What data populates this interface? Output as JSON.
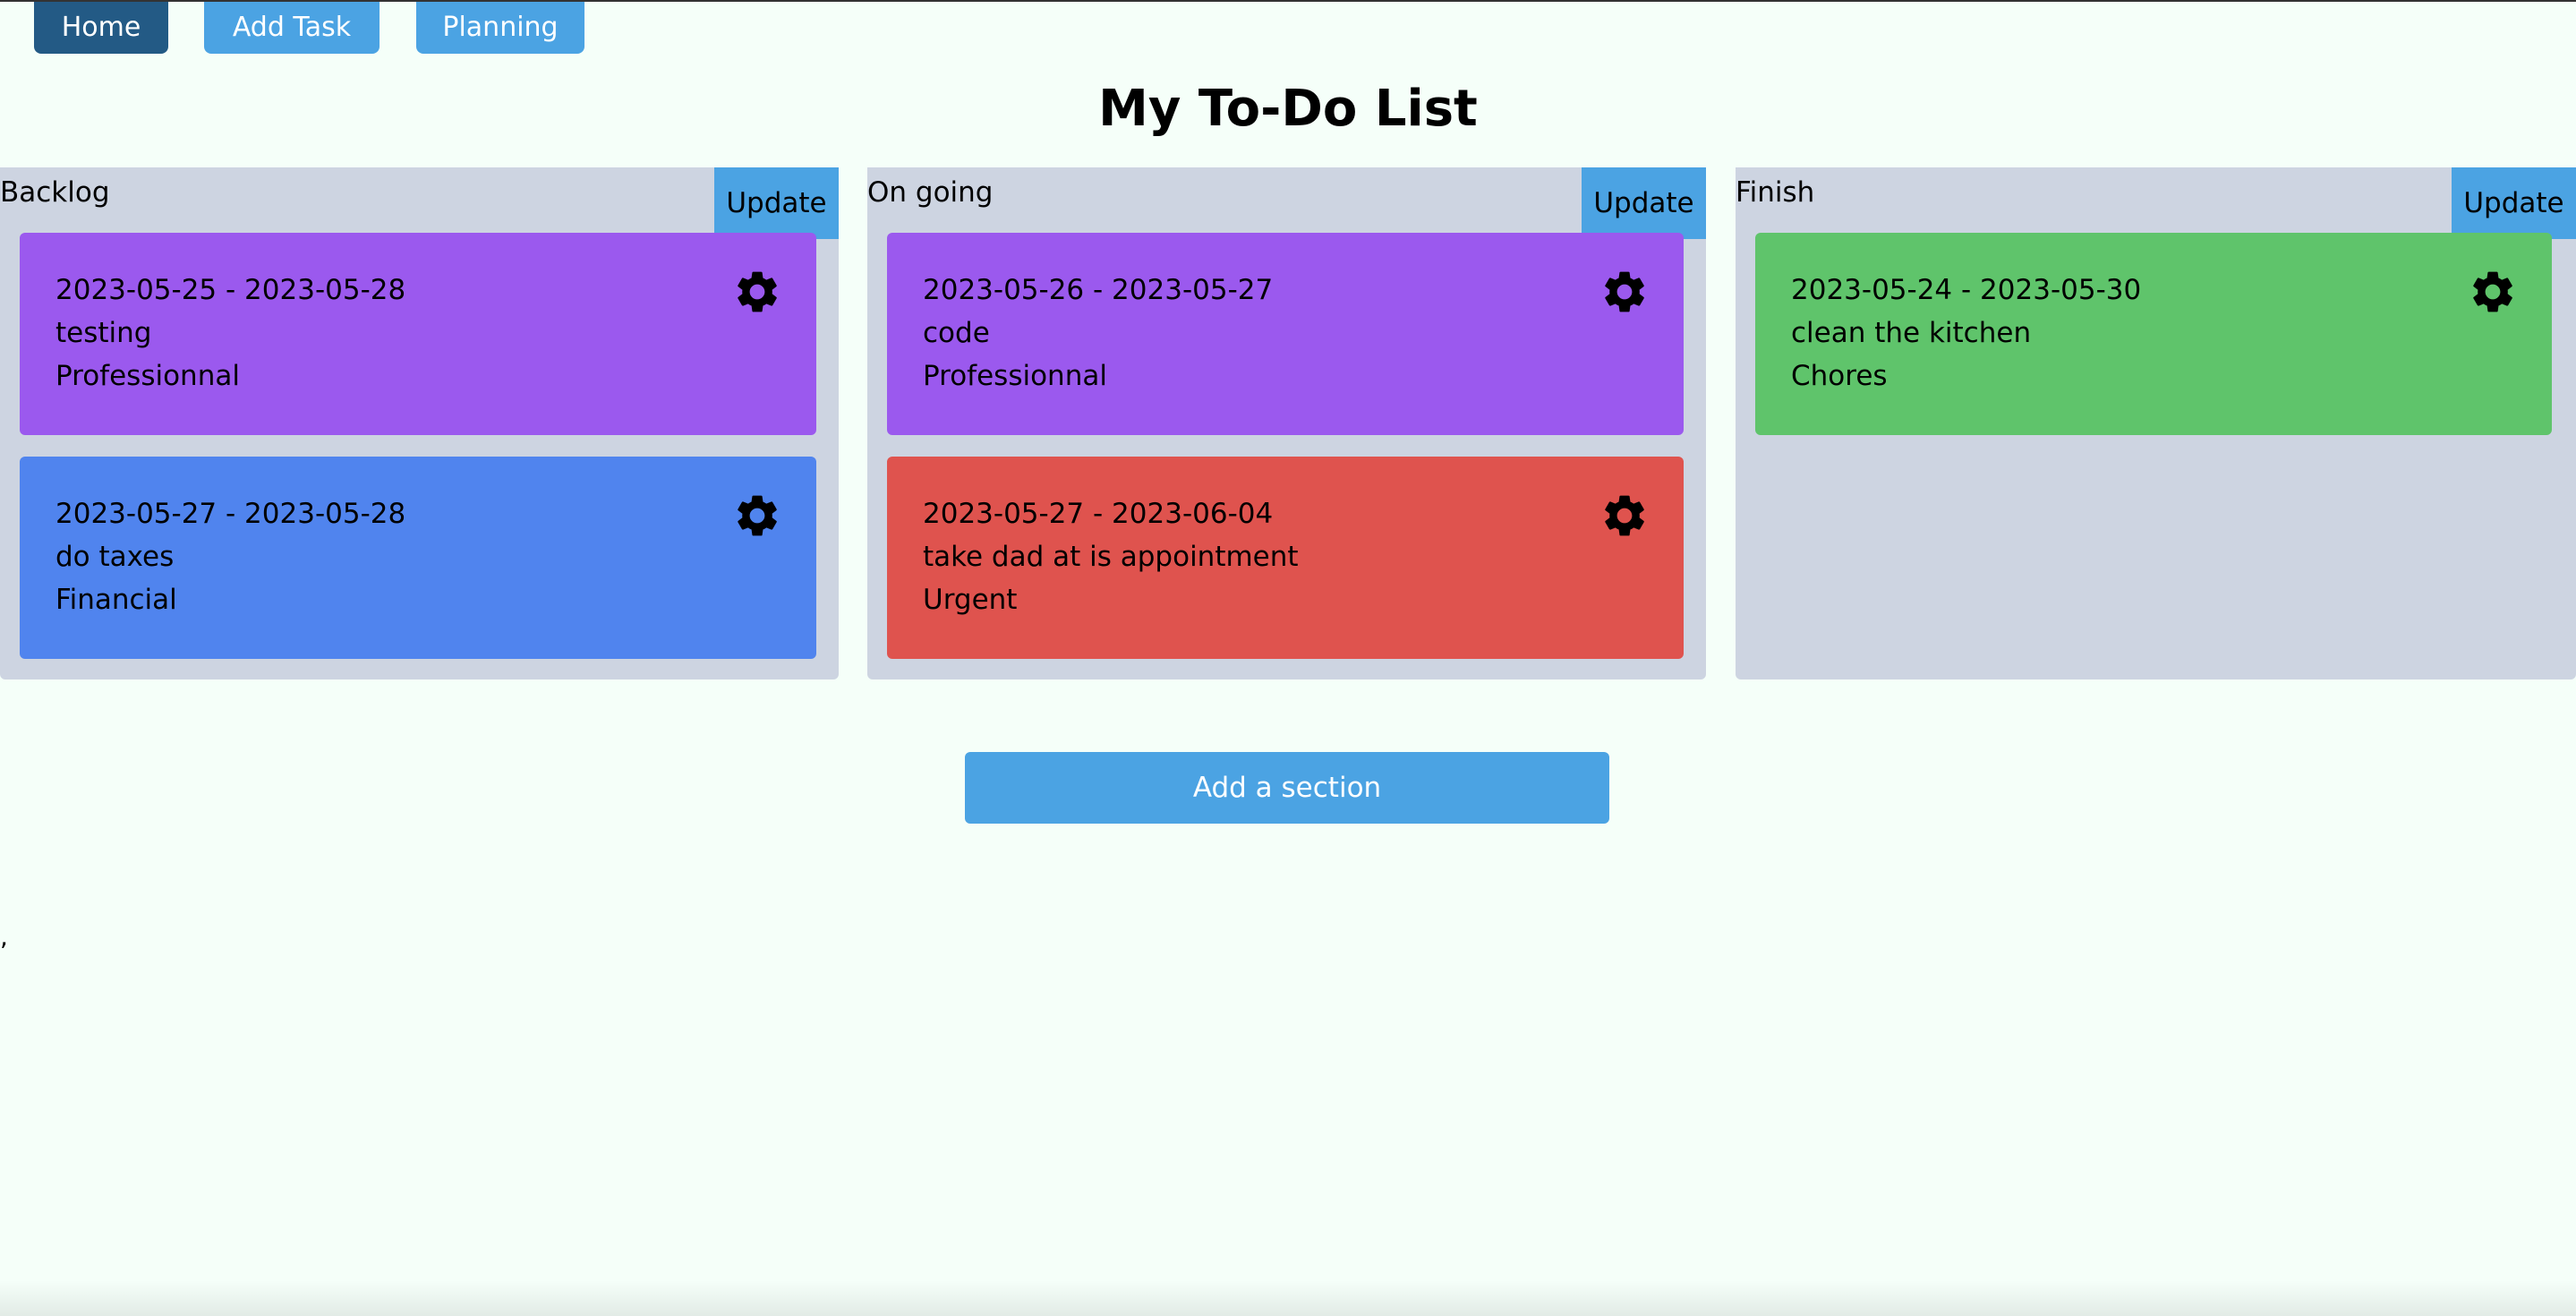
{
  "nav": {
    "home_label": "Home",
    "add_task_label": "Add Task",
    "planning_label": "Planning"
  },
  "page": {
    "title": "My To-Do List",
    "add_section_label": "Add a section",
    "stray_mark": ","
  },
  "sections": [
    {
      "title": "Backlog",
      "update_label": "Update",
      "tasks": [
        {
          "dates": "2023-05-25 - 2023-05-28",
          "name": "testing",
          "category": "Professionnal",
          "color": "#9b59ee",
          "icon": "gear-icon"
        },
        {
          "dates": "2023-05-27 - 2023-05-28",
          "name": "do taxes",
          "category": "Financial",
          "color": "#5084ee",
          "icon": "gear-icon"
        }
      ]
    },
    {
      "title": "On going",
      "update_label": "Update",
      "tasks": [
        {
          "dates": "2023-05-26 - 2023-05-27",
          "name": "code",
          "category": "Professionnal",
          "color": "#9b59ee",
          "icon": "gear-icon"
        },
        {
          "dates": "2023-05-27 - 2023-06-04",
          "name": "take dad at is appointment",
          "category": "Urgent",
          "color": "#df534e",
          "icon": "gear-icon"
        }
      ]
    },
    {
      "title": "Finish",
      "update_label": "Update",
      "tasks": [
        {
          "dates": "2023-05-24 - 2023-05-30",
          "name": "clean the kitchen",
          "category": "Chores",
          "color": "#5fc46b",
          "icon": "gear-icon"
        }
      ]
    }
  ],
  "colors": {
    "page_bg": "#f5fff9",
    "section_bg": "#cdd4e1",
    "accent": "#4ba3e3",
    "nav_active": "#235a85"
  }
}
